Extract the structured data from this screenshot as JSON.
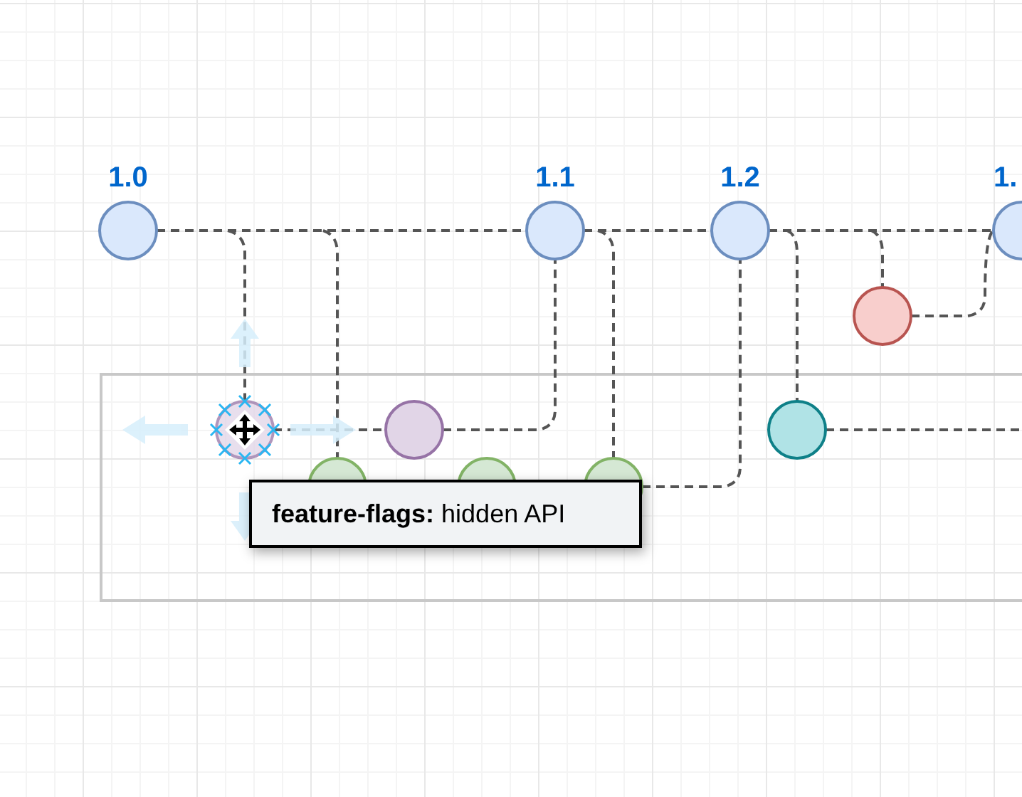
{
  "versions": [
    {
      "label": "1.0"
    },
    {
      "label": "1.1"
    },
    {
      "label": "1.2"
    },
    {
      "label": "1."
    }
  ],
  "commits": [
    {
      "color": "#dae8fc",
      "selected": false
    },
    {
      "color": "#dae8fc",
      "selected": false
    },
    {
      "color": "#dae8fc",
      "selected": false
    },
    {
      "color": "#dae8fc",
      "selected": false
    },
    {
      "color": "#f8cecc",
      "selected": false
    },
    {
      "color": "#e1d5e7",
      "selected": true
    },
    {
      "color": "#e1d5e7",
      "selected": false
    },
    {
      "color": "#b0e3e6",
      "selected": false
    },
    {
      "color": "#d5e8d4",
      "selected": false
    },
    {
      "color": "#d5e8d4",
      "selected": false
    },
    {
      "color": "#d5e8d4",
      "selected": false
    }
  ],
  "tooltip": {
    "text": "**feature-flags:** hidden API"
  }
}
